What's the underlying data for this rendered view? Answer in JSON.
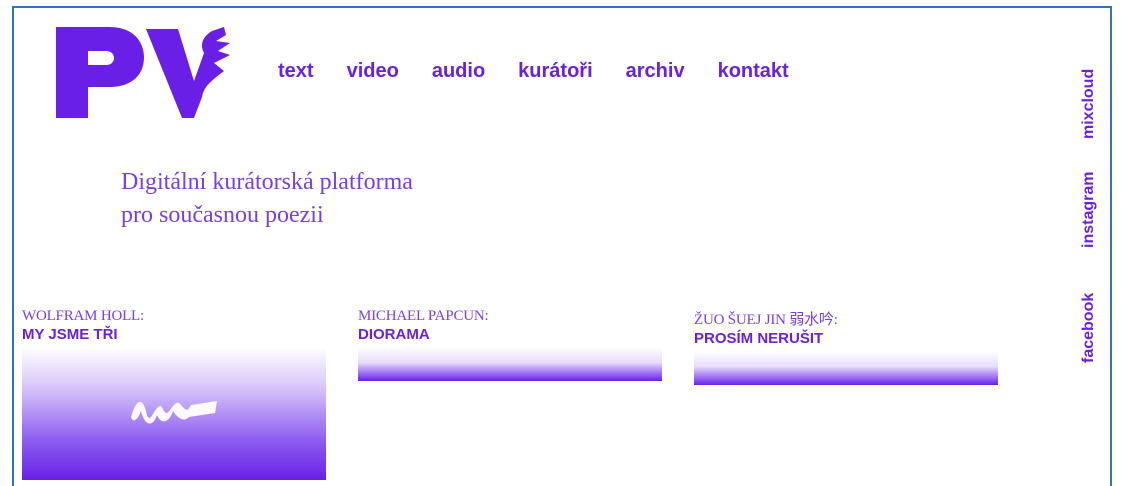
{
  "brand": {
    "logo_text": "PV",
    "accent": "#6a1fe6"
  },
  "nav": [
    {
      "label": "text"
    },
    {
      "label": "video"
    },
    {
      "label": "audio"
    },
    {
      "label": "kurátoři"
    },
    {
      "label": "archiv"
    },
    {
      "label": "kontakt"
    }
  ],
  "tagline": {
    "line1": "Digitální kurátorská platforma",
    "line2": "pro současnou poezii"
  },
  "social": [
    {
      "label": "mixcloud"
    },
    {
      "label": "instagram"
    },
    {
      "label": "facebook"
    }
  ],
  "cards": [
    {
      "author": "WOLFRAM HOLL:",
      "title": "MY JSME TŘI"
    },
    {
      "author": "MICHAEL PAPCUN:",
      "title": "DIORAMA"
    },
    {
      "author": "ŽUO ŠUEJ JIN 弱水吟:",
      "title": "PROSÍM NERUŠIT"
    }
  ]
}
